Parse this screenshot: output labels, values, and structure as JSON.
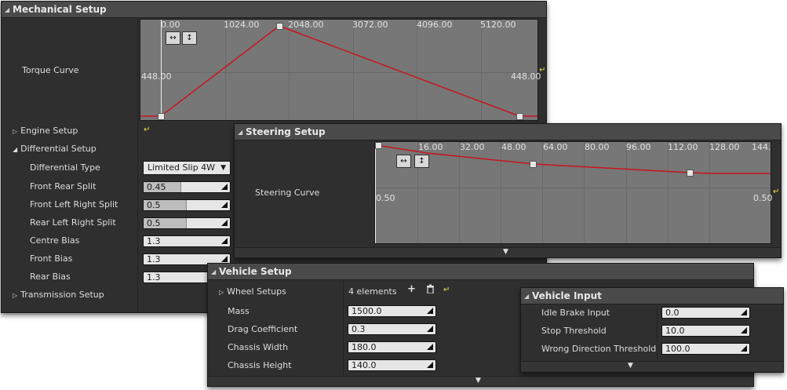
{
  "mechanical": {
    "title": "Mechanical Setup",
    "torque_label": "Torque Curve",
    "x_ticks": [
      "0.00",
      "1024.00",
      "2048.00",
      "3072.00",
      "4096.00",
      "5120.00"
    ],
    "y_left": "448.00",
    "y_right": "448.00",
    "engine_setup": "Engine Setup",
    "differential_setup": "Differential Setup",
    "differential_type_label": "Differential Type",
    "differential_type_value": "Limited Slip 4W",
    "front_rear_split_label": "Front Rear Split",
    "front_rear_split_value": "0.45",
    "front_left_right_split_label": "Front Left Right Split",
    "front_left_right_split_value": "0.5",
    "rear_left_right_split_label": "Rear Left Right Split",
    "rear_left_right_split_value": "0.5",
    "centre_bias_label": "Centre Bias",
    "centre_bias_value": "1.3",
    "front_bias_label": "Front Bias",
    "front_bias_value": "1.3",
    "rear_bias_label": "Rear Bias",
    "rear_bias_value": "1.3",
    "transmission_setup": "Transmission Setup"
  },
  "steering": {
    "title": "Steering Setup",
    "curve_label": "Steering Curve",
    "x_ticks": [
      "16.00",
      "32.00",
      "48.00",
      "64.00",
      "80.00",
      "96.00",
      "112.00",
      "128.00",
      "144."
    ],
    "y_left": "0.50",
    "y_right": "0.50"
  },
  "vehicle": {
    "title": "Vehicle Setup",
    "wheel_setups_label": "Wheel Setups",
    "wheel_setups_value": "4 elements",
    "mass_label": "Mass",
    "mass_value": "1500.0",
    "drag_label": "Drag Coefficient",
    "drag_value": "0.3",
    "chassis_width_label": "Chassis Width",
    "chassis_width_value": "180.0",
    "chassis_height_label": "Chassis Height",
    "chassis_height_value": "140.0"
  },
  "input": {
    "title": "Vehicle Input",
    "idle_brake_label": "Idle Brake Input",
    "idle_brake_value": "0.0",
    "stop_threshold_label": "Stop Threshold",
    "stop_threshold_value": "10.0",
    "wrong_direction_label": "Wrong Direction Threshold",
    "wrong_direction_value": "100.0"
  },
  "colors": {
    "curve": "#c8151b",
    "reset_arrow": "#f0e04a"
  }
}
